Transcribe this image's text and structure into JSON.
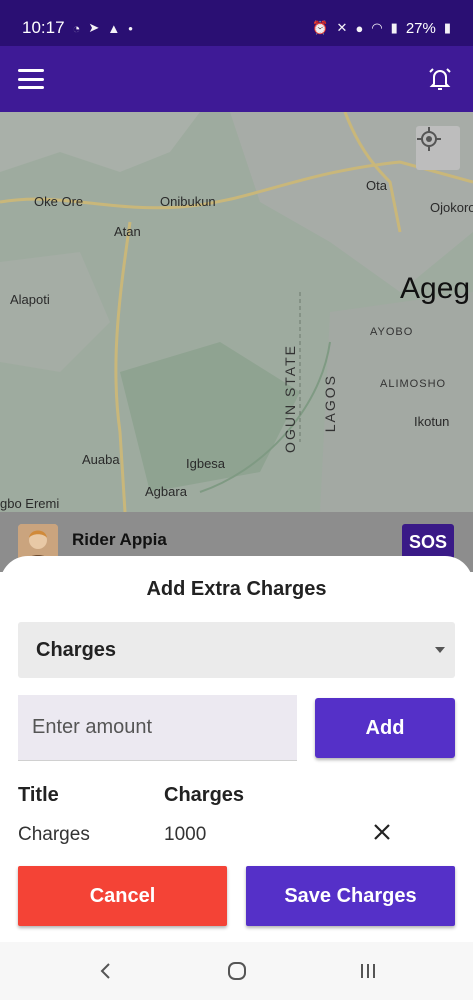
{
  "status_bar": {
    "time": "10:17",
    "battery_percent": "27%",
    "left_icons": [
      "whatsapp-icon",
      "telegram-icon",
      "bell-icon",
      "dot-icon"
    ],
    "right_icons": [
      "alarm-icon",
      "mute-icon",
      "location-icon",
      "wifi-icon",
      "signal-icon",
      "battery-icon"
    ]
  },
  "app_bar": {
    "menu_icon": "hamburger-menu-icon",
    "action_icon": "alarm-bell-icon"
  },
  "map": {
    "labels": {
      "oke_ore": "Oke Ore",
      "onibukun": "Onibukun",
      "ota": "Ota",
      "ojokoro": "Ojokoro",
      "atan": "Atan",
      "alapoti": "Alapoti",
      "agege": "Ageg",
      "ayobo": "AYOBO",
      "ogun_state": "OGUN STATE",
      "lagos": "LAGOS",
      "alimosho": "ALIMOSHO",
      "ikotun": "Ikotun",
      "auaba": "Auaba",
      "igbesa": "Igbesa",
      "agbara": "Agbara",
      "igbo_eremi": "gbo Eremi"
    },
    "locate_icon": "my-location-icon"
  },
  "rider": {
    "name": "Rider Appia",
    "sos_label": "SOS"
  },
  "sheet": {
    "title": "Add Extra Charges",
    "dropdown_value": "Charges",
    "amount_placeholder": "Enter amount",
    "add_label": "Add",
    "table_headers": {
      "title": "Title",
      "charges": "Charges"
    },
    "rows": [
      {
        "title": "Charges",
        "amount": "1000"
      }
    ],
    "cancel_label": "Cancel",
    "save_label": "Save Charges"
  },
  "colors": {
    "status_bar": "#2a0f73",
    "app_bar": "#3e1a96",
    "primary": "#5530c8",
    "cancel": "#f44336"
  },
  "nav_bar": {
    "icons": [
      "back-icon",
      "home-icon",
      "recents-icon"
    ]
  }
}
